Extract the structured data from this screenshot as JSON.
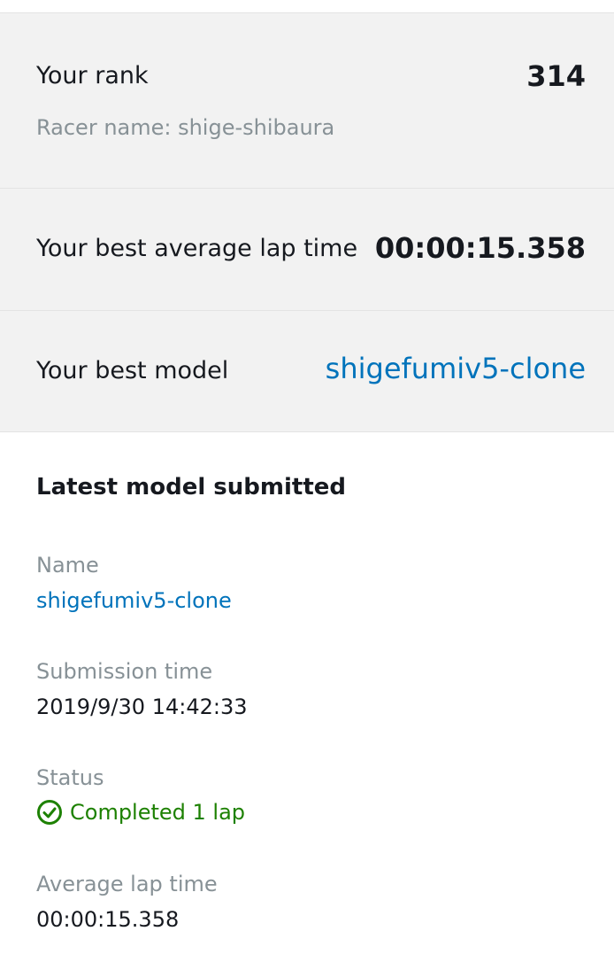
{
  "rank": {
    "label": "Your rank",
    "value": "314",
    "racer_name": "Racer name: shige-shibaura"
  },
  "best_lap": {
    "label": "Your best average lap time",
    "value": "00:00:15.358"
  },
  "best_model": {
    "label": "Your best model",
    "value": "shigefumiv5-clone"
  },
  "latest": {
    "title": "Latest model submitted",
    "name_label": "Name",
    "name_value": "shigefumiv5-clone",
    "submission_label": "Submission time",
    "submission_value": "2019/9/30 14:42:33",
    "status_label": "Status",
    "status_value": "Completed 1 lap",
    "status_icon": "check-circle-icon",
    "avg_lap_label": "Average lap time",
    "avg_lap_value": "00:00:15.358"
  },
  "colors": {
    "link": "#0073bb",
    "success": "#1d8102",
    "muted": "#879196",
    "panel": "#f2f2f2"
  }
}
